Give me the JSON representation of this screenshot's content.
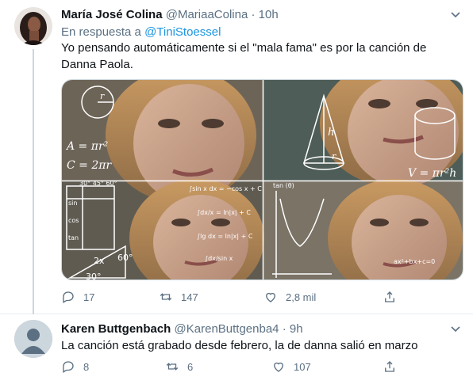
{
  "tweets": [
    {
      "name": "María José Colina",
      "handle": "@MariaaColina",
      "separator": "·",
      "time": "10h",
      "reply_prefix": "En respuesta a",
      "reply_to": "@TiniStoessel",
      "text": "Yo pensando automáticamente si el \"mala fama\" es por la canción de Danna Paola.",
      "media": {
        "formulas": {
          "area": "A = πr²",
          "circ": "C = 2πr",
          "volume": "V = πr²h",
          "r": "r",
          "h": "h",
          "r2": "r",
          "int1": "∫sin x dx = −cos x + C",
          "int2": "∫dx/x = ln|x| + C",
          "int3": "∫lg dx = ln|x| + C",
          "int4": "∫dx/sin x",
          "angles": "30°  45°  60°",
          "tri1": "2x",
          "tri2": "60°",
          "tri3": "30°",
          "tan": "tan (θ)",
          "sin": "sin",
          "cos": "cos",
          "tanl": "tan"
        }
      },
      "stats": {
        "replies": "17",
        "retweets": "147",
        "likes": "2,8 mil"
      }
    },
    {
      "name": "Karen Buttgenbach",
      "handle": "@KarenButtgenba4",
      "separator": "·",
      "time": "9h",
      "text": "La canción está grabado desde febrero, la de danna salió en marzo",
      "stats": {
        "replies": "8",
        "retweets": "6",
        "likes": "107"
      }
    }
  ],
  "colors": {
    "accent": "#1b95e0",
    "secondary_text": "#5b7083",
    "line": "#ccd6dd"
  },
  "icons": [
    "reply-icon",
    "retweet-icon",
    "like-icon",
    "share-icon",
    "caret-down-icon",
    "default-avatar-icon"
  ]
}
